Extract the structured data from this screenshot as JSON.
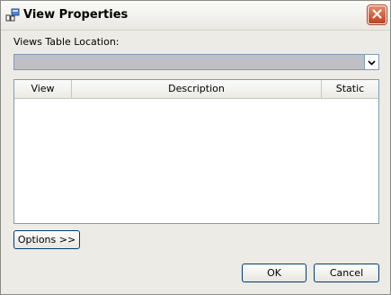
{
  "window": {
    "title": "View Properties",
    "title_icon": "view-properties-icon",
    "close_icon": "close-icon"
  },
  "form": {
    "location_label": "Views Table Location:",
    "location_value": "",
    "dropdown_icon": "chevron-down-icon"
  },
  "table": {
    "columns": [
      "View",
      "Description",
      "Static"
    ],
    "rows": []
  },
  "buttons": {
    "options": "Options >>",
    "ok": "OK",
    "cancel": "Cancel"
  },
  "colors": {
    "close_button": "#c1401f",
    "window_background": "#ecebe5",
    "combo_background": "#bfbfc6"
  }
}
